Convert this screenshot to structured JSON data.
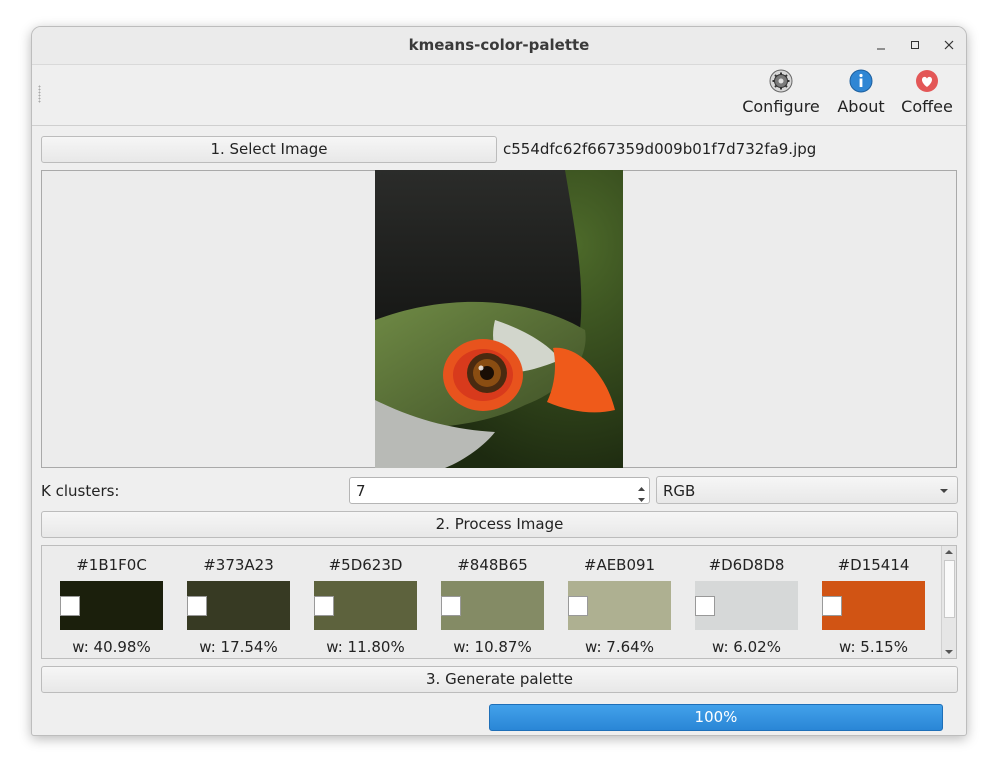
{
  "window": {
    "title": "kmeans-color-palette"
  },
  "toolbar": {
    "configure": {
      "label": "Configure",
      "icon": "gear-icon"
    },
    "about": {
      "label": "About",
      "icon": "info-icon"
    },
    "coffee": {
      "label": "Coffee",
      "icon": "heart-icon"
    }
  },
  "select": {
    "button_label": "1. Select Image",
    "filename": "c554dfc62f667359d009b01f7d732fa9.jpg"
  },
  "settings": {
    "k_label": "K clusters:",
    "k_value": "7",
    "color_space": "RGB"
  },
  "process": {
    "button_label": "2. Process Image"
  },
  "palette": {
    "colors": [
      {
        "hex": "#1B1F0C",
        "weight": "w: 40.98%"
      },
      {
        "hex": "#373A23",
        "weight": "w: 17.54%"
      },
      {
        "hex": "#5D623D",
        "weight": "w: 11.80%"
      },
      {
        "hex": "#848B65",
        "weight": "w: 10.87%"
      },
      {
        "hex": "#AEB091",
        "weight": "w: 7.64%"
      },
      {
        "hex": "#D6D8D8",
        "weight": "w: 6.02%"
      },
      {
        "hex": "#D15414",
        "weight": "w: 5.15%"
      }
    ]
  },
  "generate": {
    "button_label": "3. Generate palette"
  },
  "progress": {
    "value": 100,
    "label": "100%"
  },
  "colors": {
    "accent": "#2e8fde"
  }
}
